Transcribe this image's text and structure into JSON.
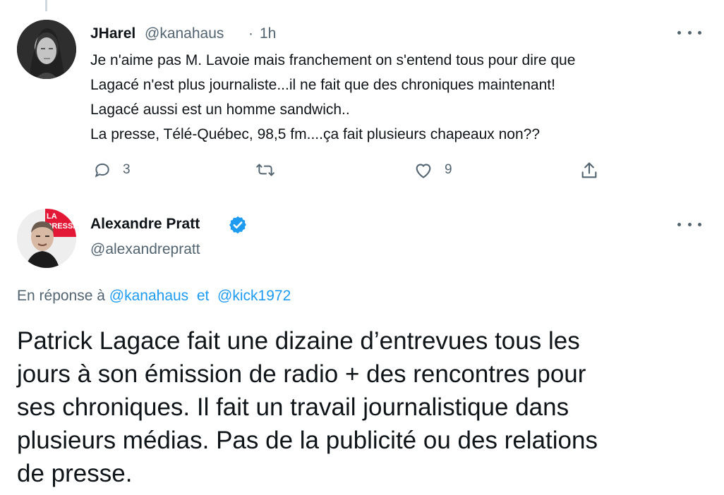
{
  "tweet1": {
    "name": "JHarel",
    "handle": "@kanahaus",
    "separator": "·",
    "time": "1h",
    "text": "Je n'aime pas M. Lavoie mais franchement on s'entend tous pour dire que\nLagacé n'est plus journaliste...il ne fait que des chroniques maintenant!\nLagacé aussi est un homme sandwich..\nLa presse, Télé-Québec, 98,5 fm....ça fait plusieurs chapeaux non??",
    "actions": {
      "reply_count": "3",
      "retweet_count": "",
      "like_count": "9"
    }
  },
  "tweet2": {
    "name": "Alexandre Pratt",
    "handle": "@alexandrepratt",
    "avatar_badge": "LA\nPRESSE",
    "reply_context": {
      "prefix": "En réponse à",
      "mention1": "@kanahaus",
      "joiner": "et",
      "mention2": "@kick1972"
    },
    "text": "Patrick Lagace fait une dizaine d’entrevues tous les\njours à son émission de radio + des rencontres pour\nses chroniques. Il fait un travail journalistique dans\nplusieurs médias. Pas de la publicité ou des relations\nde presse."
  },
  "colors": {
    "text": "#0f1419",
    "secondary": "#536471",
    "accent": "#1d9bf0",
    "thread_line": "#cfd9de",
    "brand_red": "#e31837"
  },
  "icons": [
    "reply-icon",
    "retweet-icon",
    "like-icon",
    "share-icon",
    "more-icon",
    "verified-icon"
  ]
}
